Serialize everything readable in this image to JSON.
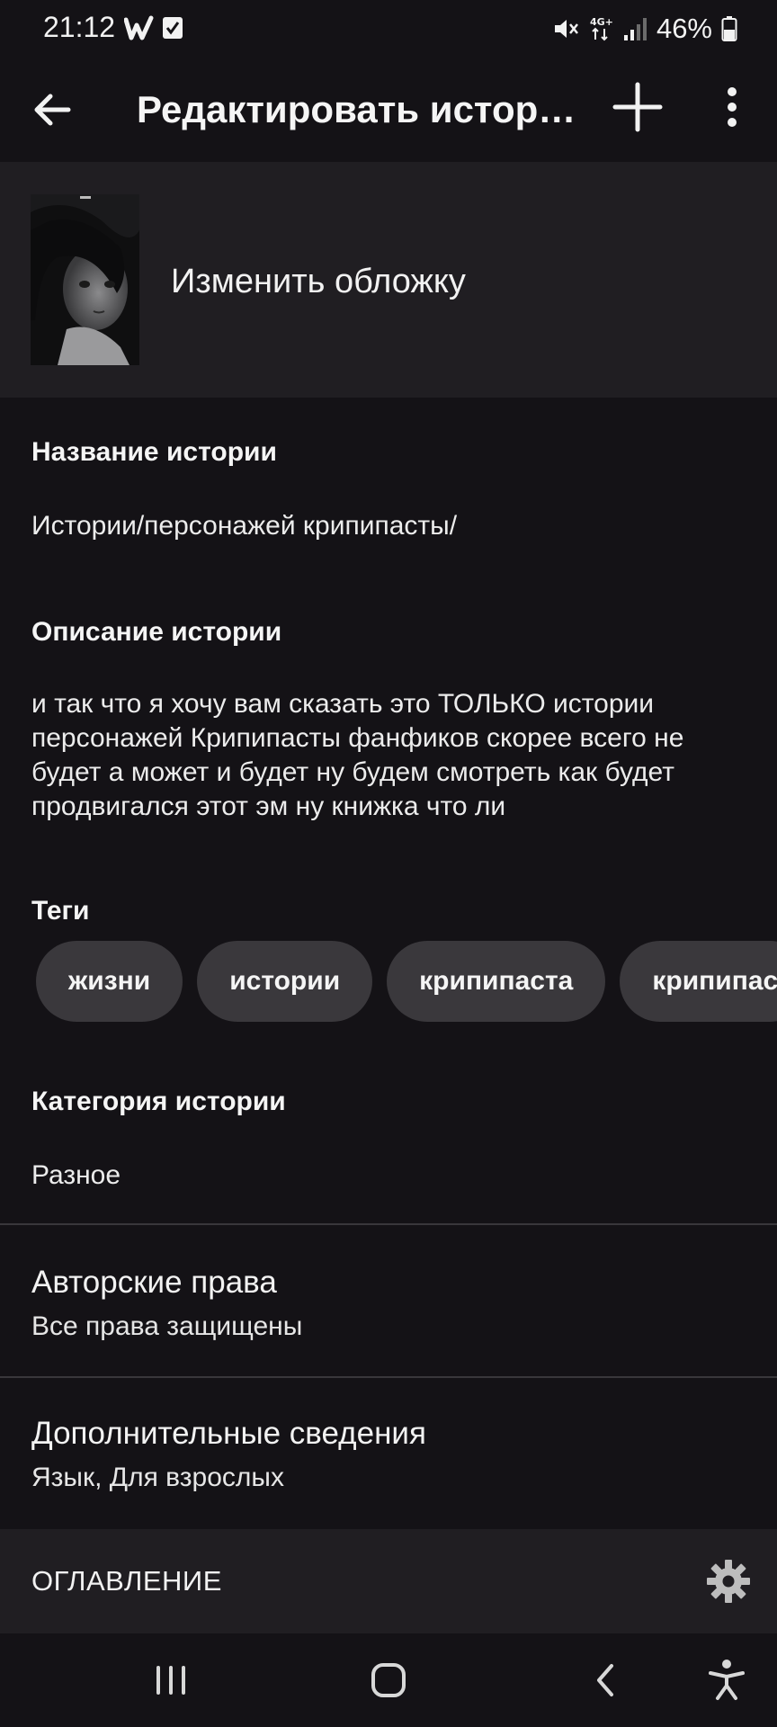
{
  "status_bar": {
    "time": "21:12",
    "battery": "46%",
    "icons": [
      "wattpad-icon",
      "checkbox-icon",
      "mute-icon",
      "network-4g-icon",
      "signal-icon",
      "battery-icon"
    ]
  },
  "app_bar": {
    "title": "Редактировать истори…",
    "icons": [
      "back-arrow-icon",
      "plus-icon",
      "more-vertical-icon"
    ]
  },
  "cover": {
    "label": "Изменить обложку"
  },
  "story": {
    "title_label": "Название истории",
    "title_value": "Истории/персонажей крипипасты/",
    "description_label": "Описание истории",
    "description_value": "и так что я хочу вам сказать это ТОЛЬКО истории персонажей Крипипасты фанфиков скорее всего не будет а может и будет ну будем смотреть как будет продвигался этот эм ну книжка что ли",
    "tags_label": "Теги",
    "tags": [
      "жизни",
      "истории",
      "крипипаста",
      "крипипас"
    ],
    "category_label": "Категория истории",
    "category_value": "Разное"
  },
  "copyright": {
    "title": "Авторские права",
    "subtitle": "Все права защищены"
  },
  "details": {
    "title": "Дополнительные сведения",
    "subtitle": "Язык, Для взрослых"
  },
  "toc": {
    "label": "ОГЛАВЛЕНИЕ",
    "icon": "gear-icon"
  },
  "nav_bar": {
    "icons": [
      "recents-icon",
      "home-icon",
      "back-icon",
      "accessibility-icon"
    ]
  }
}
